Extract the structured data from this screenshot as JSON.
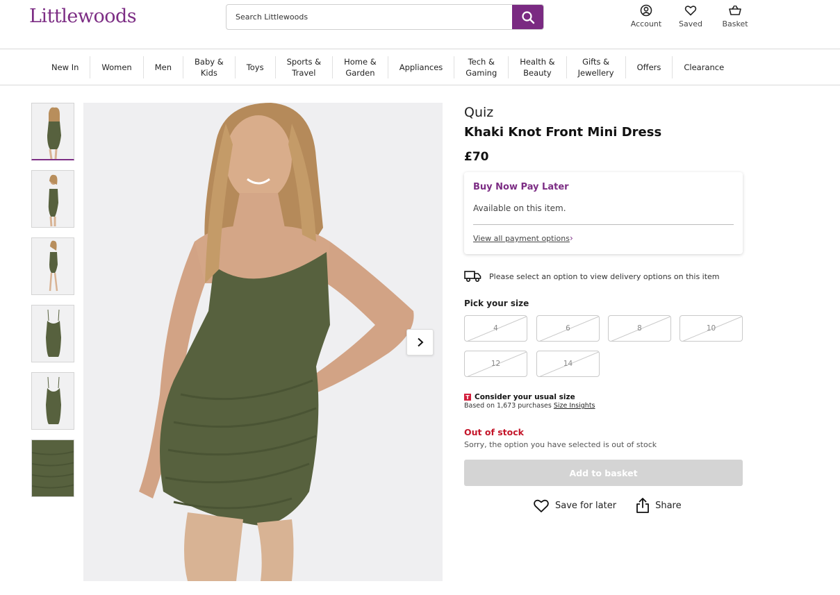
{
  "header": {
    "logo": "Littlewoods",
    "search_placeholder": "Search Littlewoods",
    "icons": [
      {
        "label": "Account",
        "icon": "account-icon"
      },
      {
        "label": "Saved",
        "icon": "heart-icon"
      },
      {
        "label": "Basket",
        "icon": "basket-icon"
      }
    ]
  },
  "nav": [
    "New In",
    "Women",
    "Men",
    "Baby &\nKids",
    "Toys",
    "Sports &\nTravel",
    "Home &\nGarden",
    "Appliances",
    "Tech &\nGaming",
    "Health &\nBeauty",
    "Gifts &\nJewellery",
    "Offers",
    "Clearance"
  ],
  "product": {
    "brand": "Quiz",
    "title": "Khaki Knot Front Mini Dress",
    "price": "£70",
    "colors": {
      "accent": "#7c2d84",
      "out_of_stock": "#c4162a",
      "disabled_button": "#d4d4d4",
      "dress": "#57613e"
    }
  },
  "bnpl": {
    "title": "Buy Now Pay Later",
    "subtitle": "Available on this item.",
    "link": "View all payment options"
  },
  "delivery": {
    "text": "Please select an option to view delivery options on this item"
  },
  "sizes": {
    "label": "Pick your size",
    "options": [
      "4",
      "6",
      "8",
      "10",
      "12",
      "14"
    ],
    "all_unavailable": true
  },
  "fit": {
    "badge": "T",
    "title": "Consider your usual size",
    "sub_prefix": "Based on 1,673 purchases",
    "link": "Size Insights"
  },
  "stock": {
    "status": "Out of stock",
    "message": "Sorry, the option you have selected is out of stock"
  },
  "buttons": {
    "add_to_basket": "Add to basket",
    "save_for_later": "Save for later",
    "share": "Share"
  }
}
